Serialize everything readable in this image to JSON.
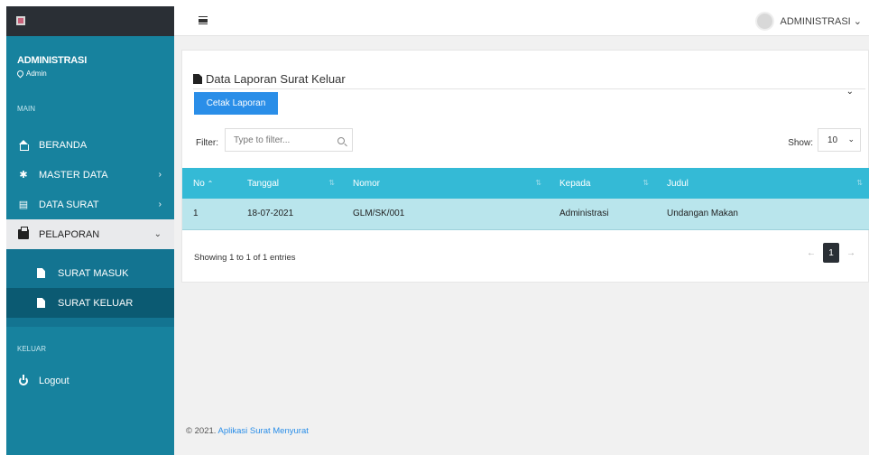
{
  "sidebar": {
    "user_name": "ADMINISTRASI",
    "user_role": "Admin",
    "section_main": "MAIN",
    "items": [
      {
        "label": "BERANDA",
        "icon": "home-icon"
      },
      {
        "label": "MASTER DATA",
        "icon": "gear-icon",
        "caret": "›"
      },
      {
        "label": "DATA SURAT",
        "icon": "document-icon",
        "caret": "›"
      },
      {
        "label": "PELAPORAN",
        "icon": "printer-icon",
        "caret": "⌄"
      }
    ],
    "sub_items": [
      {
        "label": "SURAT MASUK"
      },
      {
        "label": "SURAT KELUAR"
      }
    ],
    "section_keluar": "KELUAR",
    "logout": "Logout"
  },
  "topbar": {
    "user_label": "ADMINISTRASI ⌄"
  },
  "panel": {
    "title": "Data Laporan Surat Keluar",
    "cetak_button": "Cetak Laporan",
    "collapse": "⌄",
    "filter_label": "Filter:",
    "filter_placeholder": "Type to filter...",
    "show_label": "Show:",
    "show_value": "10"
  },
  "table": {
    "headers": [
      "No",
      "Tanggal",
      "Nomor",
      "Kepada",
      "Judul"
    ],
    "rows": [
      [
        "1",
        "18-07-2021",
        "GLM/SK/001",
        "Administrasi",
        "Undangan Makan"
      ]
    ]
  },
  "pagination": {
    "showing": "Showing 1 to 1 of 1 entries",
    "prev": "←",
    "page": "1",
    "next": "→"
  },
  "footer": {
    "prefix": "© 2021.",
    "link": "Aplikasi Surat Menyurat"
  },
  "colors": {
    "sidebar": "#17829e",
    "table_header": "#34bad6",
    "row_highlight": "#b9e5ec",
    "primary_button": "#2a8ee8"
  }
}
